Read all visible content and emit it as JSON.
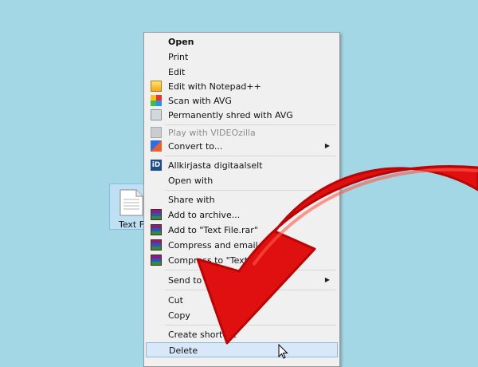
{
  "desktop": {
    "file_label": "Text Fil"
  },
  "context_menu": {
    "items": [
      {
        "label": "Open",
        "icon": "",
        "bold": true
      },
      {
        "label": "Print",
        "icon": ""
      },
      {
        "label": "Edit",
        "icon": ""
      },
      {
        "label": "Edit with Notepad++",
        "icon": "notepadpp-icon"
      },
      {
        "label": "Scan with AVG",
        "icon": "avg-icon"
      },
      {
        "label": "Permanently shred with AVG",
        "icon": "shredder-icon"
      },
      {
        "label": "Play with VIDEOzilla",
        "icon": "videozilla-icon",
        "disabled": true
      },
      {
        "label": "Convert to...",
        "icon": "convert-icon",
        "submenu": true
      },
      {
        "label": "Allkirjasta digitaalselt",
        "icon": "id-card-icon"
      },
      {
        "label": "Open with",
        "icon": ""
      },
      {
        "label": "Share with",
        "icon": ""
      },
      {
        "label": "Add to archive...",
        "icon": "winrar-icon"
      },
      {
        "label": "Add to \"Text File.rar\"",
        "icon": "winrar-icon"
      },
      {
        "label": "Compress and email...",
        "icon": "winrar-icon"
      },
      {
        "label": "Compress to \"Text",
        "icon": "winrar-icon"
      },
      {
        "label": "Send to",
        "icon": "",
        "submenu": true
      },
      {
        "label": "Cut",
        "icon": ""
      },
      {
        "label": "Copy",
        "icon": ""
      },
      {
        "label": "Create shortcut",
        "icon": ""
      },
      {
        "label": "Delete",
        "icon": "",
        "highlighted": true
      }
    ],
    "submenu_arrow": "▶"
  },
  "colors": {
    "desktop_bg": "#a3d7e6",
    "menu_bg": "#f0f0f0",
    "highlight": "#d9e8f8",
    "arrow_red": "#e01010"
  }
}
